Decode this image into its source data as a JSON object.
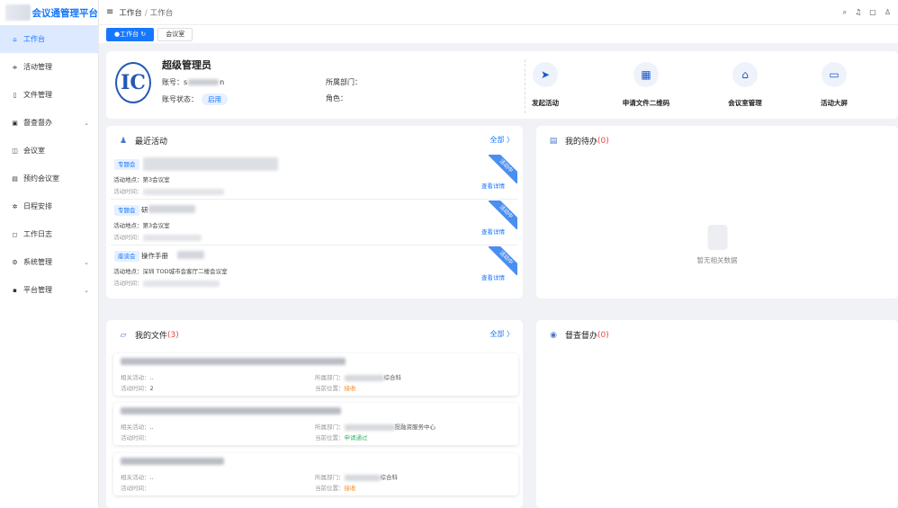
{
  "app": {
    "title": "会议通管理平台"
  },
  "sidebar": {
    "items": [
      {
        "label": "工作台",
        "icon": "home-icon",
        "active": true
      },
      {
        "label": "活动管理",
        "icon": "sliders-icon"
      },
      {
        "label": "文件管理",
        "icon": "file-icon"
      },
      {
        "label": "督查督办",
        "icon": "clipboard-icon",
        "expandable": true
      },
      {
        "label": "会议室",
        "icon": "door-icon"
      },
      {
        "label": "预约会议室",
        "icon": "calendar-icon"
      },
      {
        "label": "日程安排",
        "icon": "gear-icon"
      },
      {
        "label": "工作日志",
        "icon": "book-icon"
      },
      {
        "label": "系统管理",
        "icon": "settings-icon",
        "expandable": true
      },
      {
        "label": "平台管理",
        "icon": "grid-icon",
        "expandable": true
      }
    ]
  },
  "header": {
    "breadcrumb": [
      "工作台",
      "工作台"
    ]
  },
  "tabs": [
    {
      "label": "工作台",
      "active": true
    },
    {
      "label": "会议室",
      "active": false
    }
  ],
  "profile": {
    "name": "超级管理员",
    "account_label": "账号：",
    "account_value_prefix": "s",
    "account_value_suffix": "n",
    "status_label": "账号状态：",
    "status_value": "启用",
    "dept_label": "所属部门：",
    "role_label": "角色："
  },
  "quick_actions": [
    {
      "label": "发起活动",
      "icon": "send-icon"
    },
    {
      "label": "申请文件二维码",
      "icon": "qrcode-icon"
    },
    {
      "label": "会议室管理",
      "icon": "meeting-room-icon"
    },
    {
      "label": "活动大屏",
      "icon": "screen-icon"
    }
  ],
  "recent": {
    "title": "最近活动",
    "more": "全部 〉",
    "items": [
      {
        "tag": "专题会",
        "title": "",
        "place_label": "活动地点：",
        "place": "第3会议室",
        "time_label": "活动时间：",
        "ribbon": "活动中",
        "detail": "查看详情"
      },
      {
        "tag": "专题会",
        "title": "研",
        "place_label": "活动地点：",
        "place": "第3会议室",
        "time_label": "活动时间：",
        "ribbon": "活动中",
        "detail": "查看详情"
      },
      {
        "tag": "座谈会",
        "title": "操作手册",
        "place_label": "活动地点：",
        "place": "深圳 TOD城市会客厅二楼会议室",
        "time_label": "活动时间：",
        "ribbon": "活动中",
        "detail": "查看详情"
      }
    ]
  },
  "todo": {
    "title": "我的待办",
    "count": "(0)",
    "empty": "暂无相关数据"
  },
  "files": {
    "title": "我的文件",
    "count": "(3)",
    "more": "全部 〉",
    "items": [
      {
        "title": "",
        "related_label": "相关活动：",
        "related": "..",
        "time_label": "活动时间：",
        "time": "2",
        "dept_label": "所属部门：",
        "dept": "综合科",
        "pos_label": "当前位置：",
        "pos": "接收"
      },
      {
        "title": "",
        "related_label": "相关活动：",
        "related": "..",
        "time_label": "活动时间：",
        "time": "",
        "dept_label": "所属部门：",
        "dept": "投融资服务中心",
        "pos_label": "当前位置：",
        "pos": "申请通过"
      },
      {
        "title": "",
        "related_label": "相关活动：",
        "related": "..",
        "time_label": "活动时间：",
        "time": "",
        "dept_label": "所属部门：",
        "dept": "综合科",
        "pos_label": "当前位置：",
        "pos": "接收"
      }
    ]
  },
  "supervise": {
    "title": "督查督办",
    "count": "(0)"
  },
  "colors": {
    "accent": "#1677ff",
    "orange": "#f08a24",
    "green": "#3db36b",
    "red": "#e54848"
  }
}
